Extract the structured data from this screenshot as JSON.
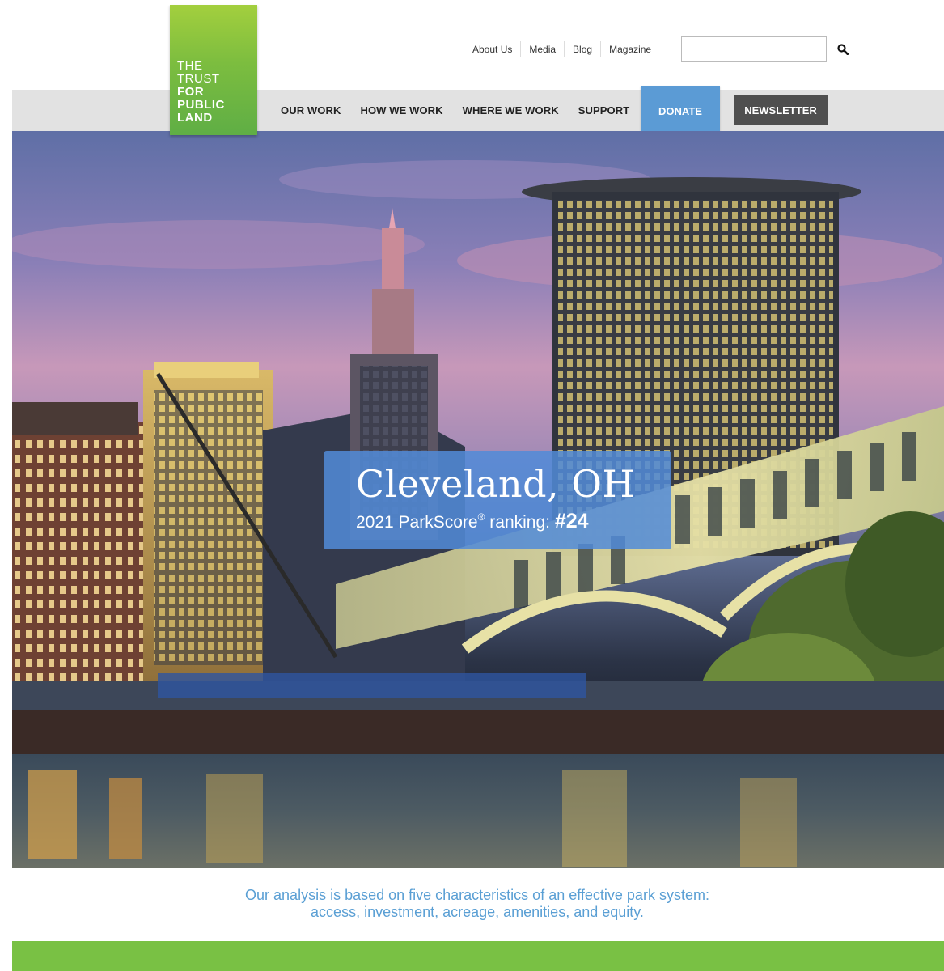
{
  "logo": {
    "line1": "THE",
    "line2": "TRUST",
    "line3": "FOR",
    "line4": "PUBLIC",
    "line5": "LAND"
  },
  "utility_nav": [
    {
      "label": "About Us"
    },
    {
      "label": "Media"
    },
    {
      "label": "Blog"
    },
    {
      "label": "Magazine"
    }
  ],
  "search": {
    "placeholder": "",
    "value": "",
    "icon": "search-icon"
  },
  "main_nav": [
    {
      "label": "OUR WORK"
    },
    {
      "label": "HOW WE WORK"
    },
    {
      "label": "WHERE WE WORK"
    },
    {
      "label": "SUPPORT"
    }
  ],
  "donate_label": "DONATE",
  "newsletter_label": "NEWSLETTER",
  "hero": {
    "city": "Cleveland, OH",
    "rank_prefix": "2021 ParkScore",
    "rank_reg": "®",
    "rank_mid": " ranking: ",
    "rank_value": "#24"
  },
  "analysis": {
    "line1": "Our analysis is based on five characteristics of an effective park system:",
    "line2": "access, investment, acreage, amenities, and equity."
  },
  "colors": {
    "logo_green": "#7cbd3f",
    "donate_blue": "#5b9bd5",
    "newsletter_gray": "#4f4f4f",
    "band_green": "#79c144",
    "analysis_text": "#5a9fd4"
  }
}
